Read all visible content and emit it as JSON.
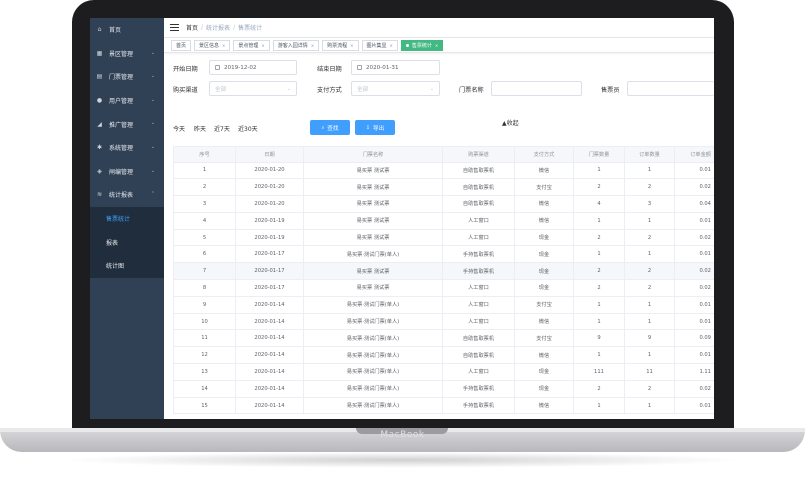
{
  "device": {
    "label": "MacBook"
  },
  "sidebar": {
    "items": [
      {
        "icon": "home-icon",
        "glyph": "⌂",
        "label": "首页",
        "chevron": false
      },
      {
        "icon": "grid-icon",
        "glyph": "▦",
        "label": "景区管理",
        "chevron": true
      },
      {
        "icon": "ticket-icon",
        "glyph": "▤",
        "label": "门票管理",
        "chevron": true
      },
      {
        "icon": "user-icon",
        "glyph": "●",
        "label": "用户管理",
        "chevron": true
      },
      {
        "icon": "promo-icon",
        "glyph": "◢",
        "label": "推广管理",
        "chevron": true
      },
      {
        "icon": "gear-icon",
        "glyph": "✱",
        "label": "系统管理",
        "chevron": true
      },
      {
        "icon": "shield-icon",
        "glyph": "◈",
        "label": "闸编管理",
        "chevron": true
      },
      {
        "icon": "chart-icon",
        "glyph": "≋",
        "label": "统计报表",
        "chevron": true
      }
    ],
    "sub_items": [
      {
        "label": "售票统计",
        "active": true
      },
      {
        "label": "报表",
        "active": false
      },
      {
        "label": "统计图",
        "active": false
      }
    ]
  },
  "navbar": {
    "breadcrumb": [
      "首页",
      "统计报表",
      "售票统计"
    ]
  },
  "tags": [
    {
      "label": "首页",
      "closable": false,
      "active": false
    },
    {
      "label": "景区信息",
      "closable": true,
      "active": false
    },
    {
      "label": "景点管理",
      "closable": true,
      "active": false
    },
    {
      "label": "游客入园详情",
      "closable": true,
      "active": false
    },
    {
      "label": "购票流程",
      "closable": true,
      "active": false
    },
    {
      "label": "图片集显",
      "closable": true,
      "active": false
    },
    {
      "label": "售票统计",
      "closable": true,
      "active": true
    }
  ],
  "filters": {
    "start_label": "开始日期",
    "start_value": "2019-12-02",
    "end_label": "结束日期",
    "end_value": "2020-01-31",
    "channel_label": "购买渠道",
    "channel_value": "全部",
    "pay_label": "支付方式",
    "pay_value": "全部",
    "ticket_label": "门票名称",
    "ticket_value": "",
    "seller_label": "售票员",
    "seller_value": "",
    "quick": [
      "今天",
      "昨天",
      "近7天",
      "近30天"
    ],
    "search_label": "查找",
    "export_label": "导出",
    "collapse_label": "▲收起"
  },
  "table": {
    "headers": [
      "序号",
      "日期",
      "门票名称",
      "购票渠道",
      "支付方式",
      "门票数量",
      "订单数量",
      "订单金额"
    ],
    "rows": [
      [
        "1",
        "2020-01-20",
        "易买票 测试票",
        "自助售取票机",
        "微信",
        "1",
        "1",
        "0.01"
      ],
      [
        "2",
        "2020-01-20",
        "易买票 测试票",
        "自助售取票机",
        "支付宝",
        "2",
        "2",
        "0.02"
      ],
      [
        "3",
        "2020-01-20",
        "易买票 测试票",
        "自助售取票机",
        "微信",
        "4",
        "3",
        "0.04"
      ],
      [
        "4",
        "2020-01-19",
        "易买票 测试票",
        "人工窗口",
        "微信",
        "1",
        "1",
        "0.01"
      ],
      [
        "5",
        "2020-01-19",
        "易买票 测试票",
        "人工窗口",
        "现金",
        "2",
        "2",
        "0.02"
      ],
      [
        "6",
        "2020-01-17",
        "易买票·测试门票(单人)",
        "手持售取票机",
        "现金",
        "1",
        "1",
        "0.01"
      ],
      [
        "7",
        "2020-01-17",
        "易买票 测试票",
        "手持售取票机",
        "现金",
        "2",
        "2",
        "0.02"
      ],
      [
        "8",
        "2020-01-17",
        "易买票 测试票",
        "人工窗口",
        "现金",
        "2",
        "2",
        "0.02"
      ],
      [
        "9",
        "2020-01-14",
        "易买票·测试门票(单人)",
        "人工窗口",
        "支付宝",
        "1",
        "1",
        "0.01"
      ],
      [
        "10",
        "2020-01-14",
        "易买票·测试门票(单人)",
        "人工窗口",
        "微信",
        "1",
        "1",
        "0.01"
      ],
      [
        "11",
        "2020-01-14",
        "易买票·测试门票(单人)",
        "自助售取票机",
        "支付宝",
        "9",
        "9",
        "0.09"
      ],
      [
        "12",
        "2020-01-14",
        "易买票·测试门票(单人)",
        "自助售取票机",
        "微信",
        "1",
        "1",
        "0.01"
      ],
      [
        "13",
        "2020-01-14",
        "易买票·测试门票(单人)",
        "人工窗口",
        "现金",
        "111",
        "11",
        "1.11"
      ],
      [
        "14",
        "2020-01-14",
        "易买票·测试门票(单人)",
        "手持售取票机",
        "现金",
        "2",
        "2",
        "0.02"
      ],
      [
        "15",
        "2020-01-14",
        "易买票·测试门票(单人)",
        "手持售取票机",
        "微信",
        "1",
        "1",
        "0.01"
      ]
    ],
    "hover_row": 6
  }
}
